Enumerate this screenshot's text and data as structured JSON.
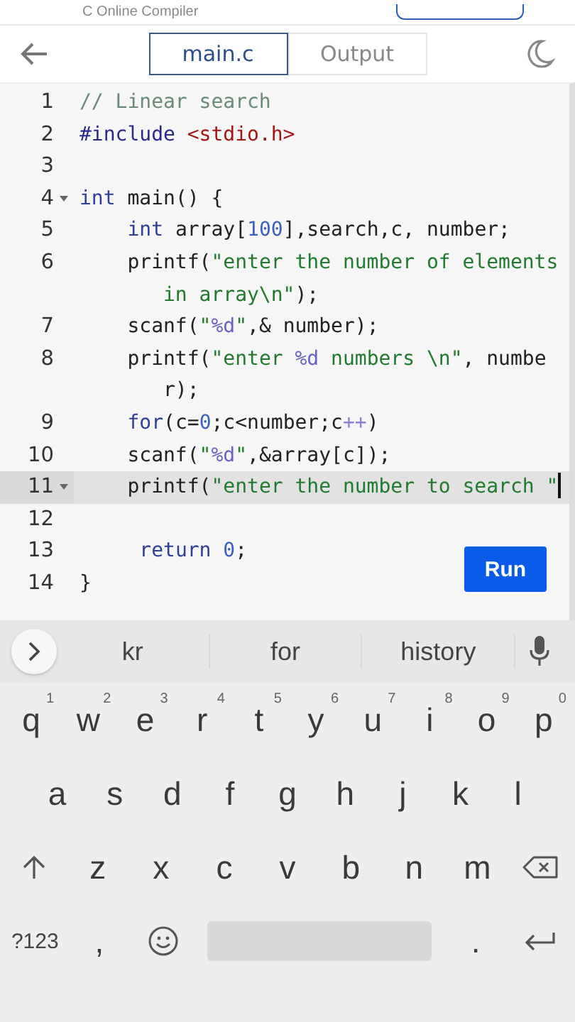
{
  "header": {
    "title": "C Online Compiler"
  },
  "toolbar": {
    "tabs": [
      {
        "label": "main.c",
        "selected": true
      },
      {
        "label": "Output",
        "selected": false
      }
    ]
  },
  "editor": {
    "lines": [
      {
        "number": "1",
        "foldable": false,
        "active": false,
        "tokens": [
          {
            "kind": "comment",
            "text": "// Linear search"
          }
        ]
      },
      {
        "number": "2",
        "foldable": false,
        "active": false,
        "tokens": [
          {
            "kind": "meta",
            "text": "#include "
          },
          {
            "kind": "header",
            "text": "<stdio.h>"
          }
        ]
      },
      {
        "number": "3",
        "foldable": false,
        "active": false
      },
      {
        "number": "4",
        "foldable": true,
        "active": false,
        "tokens": [
          {
            "kind": "keyword",
            "text": "int"
          },
          {
            "kind": "plain",
            "text": " main() {"
          }
        ]
      },
      {
        "number": "5",
        "foldable": false,
        "active": false,
        "tokens": [
          {
            "kind": "keyword",
            "text": "    int"
          },
          {
            "kind": "plain",
            "text": " array["
          },
          {
            "kind": "number",
            "text": "100"
          },
          {
            "kind": "plain",
            "text": "],search,c, number;"
          }
        ]
      },
      {
        "number": "6",
        "foldable": false,
        "active": false,
        "tokens": [
          {
            "kind": "plain",
            "text": "    printf("
          },
          {
            "kind": "string",
            "text": "\"enter the number of elements in array\\n\""
          },
          {
            "kind": "plain",
            "text": ");"
          }
        ]
      },
      {
        "number": "7",
        "foldable": false,
        "active": false,
        "tokens": [
          {
            "kind": "plain",
            "text": "    scanf("
          },
          {
            "kind": "string",
            "text": "\""
          },
          {
            "kind": "format",
            "text": "%d"
          },
          {
            "kind": "string",
            "text": "\""
          },
          {
            "kind": "plain",
            "text": ",& number);"
          }
        ]
      },
      {
        "number": "8",
        "foldable": false,
        "active": false,
        "tokens": [
          {
            "kind": "plain",
            "text": "    printf("
          },
          {
            "kind": "string",
            "text": "\"enter "
          },
          {
            "kind": "format",
            "text": "%d"
          },
          {
            "kind": "string",
            "text": " numbers \\n\""
          },
          {
            "kind": "plain",
            "text": ", number);"
          }
        ]
      },
      {
        "number": "9",
        "foldable": false,
        "active": false,
        "tokens": [
          {
            "kind": "keyword",
            "text": "    for"
          },
          {
            "kind": "plain",
            "text": "(c="
          },
          {
            "kind": "number",
            "text": "0"
          },
          {
            "kind": "plain",
            "text": ";c<number;c"
          },
          {
            "kind": "operator",
            "text": "++"
          },
          {
            "kind": "plain",
            "text": ")"
          }
        ]
      },
      {
        "number": "10",
        "foldable": false,
        "active": false,
        "tokens": [
          {
            "kind": "plain",
            "text": "    scanf("
          },
          {
            "kind": "string",
            "text": "\""
          },
          {
            "kind": "format",
            "text": "%d"
          },
          {
            "kind": "string",
            "text": "\""
          },
          {
            "kind": "plain",
            "text": ",&array[c]);"
          }
        ]
      },
      {
        "number": "11",
        "foldable": true,
        "active": true,
        "tokens": [
          {
            "kind": "plain",
            "text": "    printf("
          },
          {
            "kind": "string",
            "text": "\"enter the number to search \""
          }
        ]
      },
      {
        "number": "12",
        "foldable": false,
        "active": false
      },
      {
        "number": "13",
        "foldable": false,
        "active": false,
        "tokens": [
          {
            "kind": "keyword",
            "text": "     return"
          },
          {
            "kind": "number",
            "text": " 0"
          },
          {
            "kind": "plain",
            "text": ";"
          }
        ]
      },
      {
        "number": "14",
        "foldable": false,
        "active": false,
        "tokens": [
          {
            "kind": "plain",
            "text": "}"
          }
        ]
      }
    ],
    "run_button": "Run"
  },
  "keyboard": {
    "suggestions": [
      "kr",
      "for",
      "history"
    ],
    "rows": [
      [
        {
          "kind": "letter",
          "label": "q",
          "hint": "1"
        },
        {
          "kind": "letter",
          "label": "w",
          "hint": "2"
        },
        {
          "kind": "letter",
          "label": "e",
          "hint": "3"
        },
        {
          "kind": "letter",
          "label": "r",
          "hint": "4"
        },
        {
          "kind": "letter",
          "label": "t",
          "hint": "5"
        },
        {
          "kind": "letter",
          "label": "y",
          "hint": "6"
        },
        {
          "kind": "letter",
          "label": "u",
          "hint": "7"
        },
        {
          "kind": "letter",
          "label": "i",
          "hint": "8"
        },
        {
          "kind": "letter",
          "label": "o",
          "hint": "9"
        },
        {
          "kind": "letter",
          "label": "p",
          "hint": "0"
        }
      ],
      [
        {
          "kind": "letter",
          "label": "a"
        },
        {
          "kind": "letter",
          "label": "s"
        },
        {
          "kind": "letter",
          "label": "d"
        },
        {
          "kind": "letter",
          "label": "f"
        },
        {
          "kind": "letter",
          "label": "g"
        },
        {
          "kind": "letter",
          "label": "h"
        },
        {
          "kind": "letter",
          "label": "j"
        },
        {
          "kind": "letter",
          "label": "k"
        },
        {
          "kind": "letter",
          "label": "l"
        }
      ],
      [
        {
          "kind": "shift"
        },
        {
          "kind": "letter",
          "label": "z"
        },
        {
          "kind": "letter",
          "label": "x"
        },
        {
          "kind": "letter",
          "label": "c"
        },
        {
          "kind": "letter",
          "label": "v"
        },
        {
          "kind": "letter",
          "label": "b"
        },
        {
          "kind": "letter",
          "label": "n"
        },
        {
          "kind": "letter",
          "label": "m"
        },
        {
          "kind": "backspace"
        }
      ],
      [
        {
          "kind": "symbols",
          "label": "?123"
        },
        {
          "kind": "punct",
          "label": ","
        },
        {
          "kind": "emoji"
        },
        {
          "kind": "space"
        },
        {
          "kind": "punct",
          "label": "."
        },
        {
          "kind": "enter"
        }
      ]
    ]
  }
}
